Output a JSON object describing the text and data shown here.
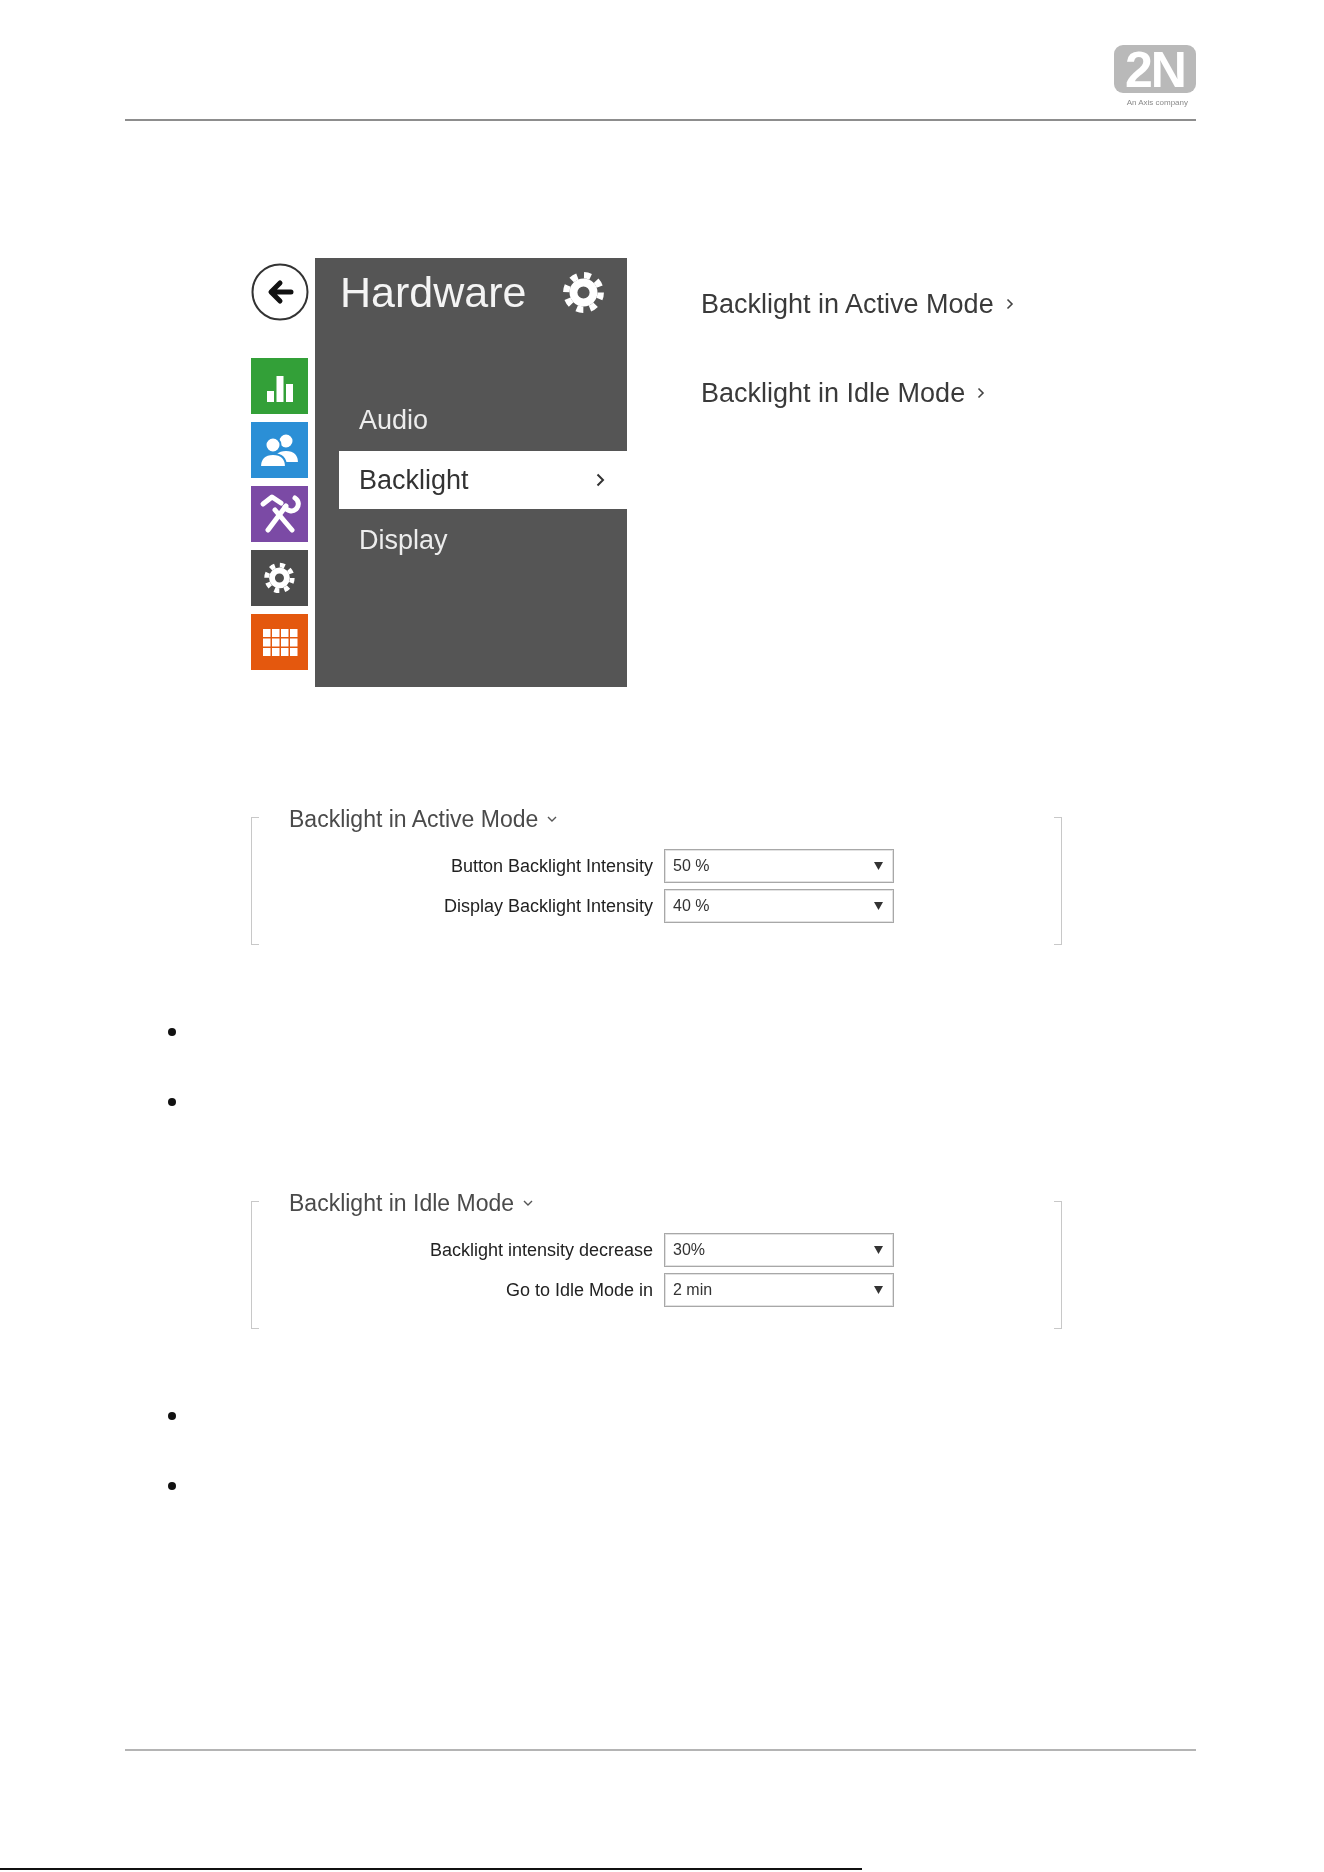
{
  "header": {
    "logo": "2N",
    "tagline": "An Axis company"
  },
  "screenshot": {
    "nav_tiles": [
      {
        "kind": "chart",
        "color": "#33a038"
      },
      {
        "kind": "users",
        "color": "#2b8fd6"
      },
      {
        "kind": "tools",
        "color": "#7b4aa5"
      },
      {
        "kind": "settings",
        "color": "#4d4d4d"
      },
      {
        "kind": "grid",
        "color": "#e4580e"
      }
    ],
    "panel": {
      "title": "Hardware",
      "menu": [
        {
          "label": "Audio",
          "selected": false
        },
        {
          "label": "Backlight",
          "selected": true
        },
        {
          "label": "Display",
          "selected": false
        }
      ]
    },
    "links": [
      "Backlight in Active Mode",
      "Backlight in Idle Mode"
    ]
  },
  "sections": [
    {
      "title": "Backlight in Active Mode",
      "fields": [
        {
          "label": "Button Backlight Intensity",
          "value": "50 %"
        },
        {
          "label": "Display Backlight Intensity",
          "value": "40 %"
        }
      ],
      "bullets": [
        {
          "kind": "dot"
        },
        {
          "kind": "dot"
        }
      ]
    },
    {
      "title": "Backlight in Idle Mode",
      "fields": [
        {
          "label": "Backlight intensity decrease",
          "value": "30%"
        },
        {
          "label": "Go to Idle Mode in",
          "value": "2 min"
        }
      ],
      "bullets": [
        {
          "kind": "dot"
        },
        {
          "kind": "dot"
        }
      ]
    }
  ]
}
